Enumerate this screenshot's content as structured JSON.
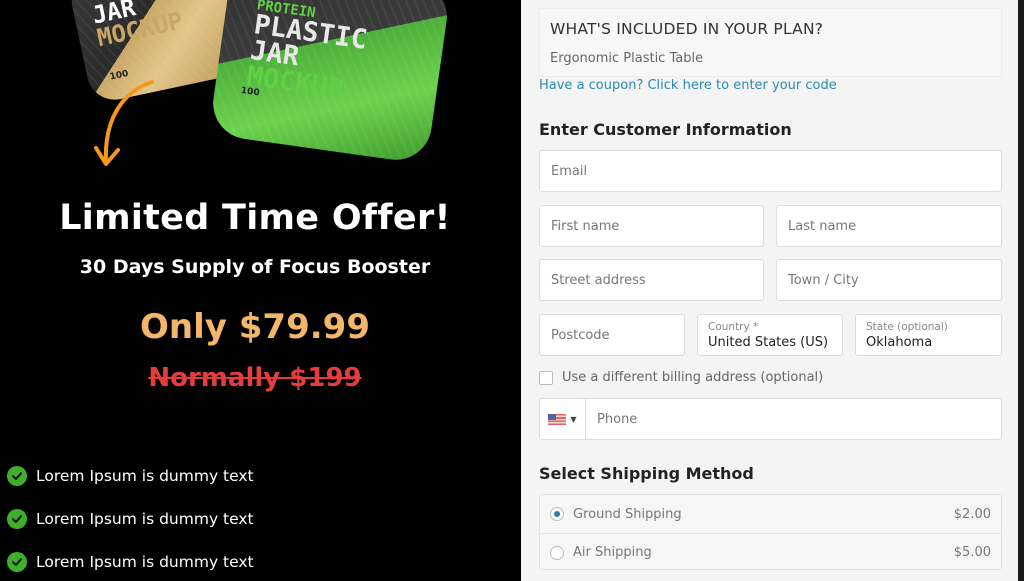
{
  "product": {
    "jar_gold_title": [
      "JAR",
      "MOCKUP"
    ],
    "jar_gold_meta": "100",
    "jar_green_title": [
      "PROTEIN",
      "PLASTIC",
      "JAR",
      "MOCKUP"
    ],
    "jar_green_meta": "100"
  },
  "offer": {
    "title": "Limited Time Offer!",
    "subtitle": "30 Days Supply of Focus Booster",
    "price": "Only $79.99",
    "old_price": "Normally $199"
  },
  "features": [
    "Lorem Ipsum is dummy text",
    "Lorem Ipsum is dummy text",
    "Lorem Ipsum is dummy text"
  ],
  "plan": {
    "title": "WHAT'S INCLUDED IN YOUR PLAN?",
    "item": "Ergonomic Plastic Table"
  },
  "coupon_link": "Have a coupon? Click here to enter your code",
  "customer": {
    "title": "Enter Customer Information",
    "email_placeholder": "Email",
    "first_name_placeholder": "First name",
    "last_name_placeholder": "Last name",
    "street_placeholder": "Street address",
    "city_placeholder": "Town / City",
    "postcode_placeholder": "Postcode",
    "country_label": "Country *",
    "country_value": "United States (US)",
    "state_label": "State (optional)",
    "state_value": "Oklahoma",
    "billing_label": "Use a different billing address (optional)",
    "phone_placeholder": "Phone",
    "phone_country": "US"
  },
  "shipping": {
    "title": "Select Shipping Method",
    "options": [
      {
        "label": "Ground Shipping",
        "price": "$2.00",
        "selected": true
      },
      {
        "label": "Air Shipping",
        "price": "$5.00",
        "selected": false
      }
    ]
  },
  "colors": {
    "price": "#f4b66a",
    "old_price": "#e33d3d",
    "check": "#3fae2a",
    "link": "#2a8bb0",
    "radio": "#2a7fa5"
  }
}
